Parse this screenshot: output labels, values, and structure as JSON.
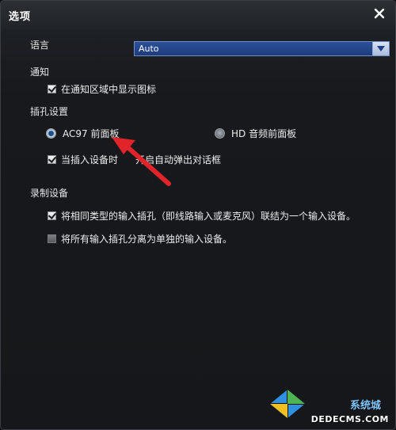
{
  "window": {
    "title": "选项"
  },
  "language": {
    "label": "语言",
    "value": "Auto"
  },
  "notify": {
    "label": "通知",
    "show_icon_label": "在通知区域中显示图标",
    "show_icon_checked": true
  },
  "jack": {
    "label": "插孔设置",
    "ac97_label": "AC97 前面板",
    "hd_label": "HD 音频前面板",
    "selected": "ac97",
    "autopopup_label_part1": "当插入设备时",
    "autopopup_label_part2": "开启自动弹出对话框",
    "autopopup_checked": true
  },
  "record": {
    "label": "录制设备",
    "combine_label": "将相同类型的输入插孔（即线路输入或麦克风）联结为一个输入设备。",
    "combine_checked": true,
    "separate_label": "将所有输入插孔分离为单独的输入设备。",
    "separate_checked": false
  },
  "watermark": {
    "line1": "系统城",
    "line2": "DEDECMS.COM"
  },
  "colors": {
    "accent_select": "#2b4f98",
    "annotation_arrow": "#e0242a",
    "background": "#17191c"
  }
}
